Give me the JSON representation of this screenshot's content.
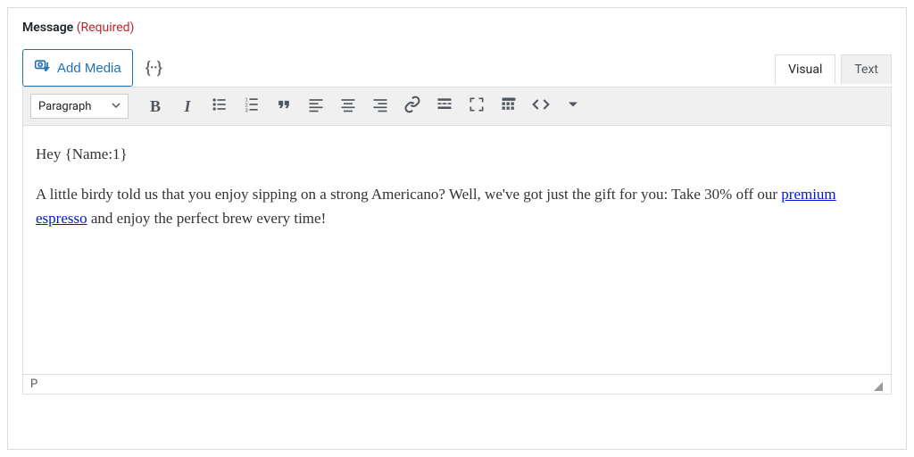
{
  "field": {
    "label": "Message",
    "required_text": "(Required)"
  },
  "media": {
    "add_media_label": "Add Media"
  },
  "tabs": {
    "visual": "Visual",
    "text": "Text"
  },
  "toolbar": {
    "format": "Paragraph"
  },
  "content": {
    "greeting": "Hey {Name:1}",
    "body_before_link": "A little birdy told us that you enjoy sipping on a strong Americano? Well, we've got just the gift for you: Take 30% off our ",
    "link_text": "premium espresso",
    "body_after_link": " and enjoy the perfect brew every time!"
  },
  "status": {
    "path": "P"
  }
}
